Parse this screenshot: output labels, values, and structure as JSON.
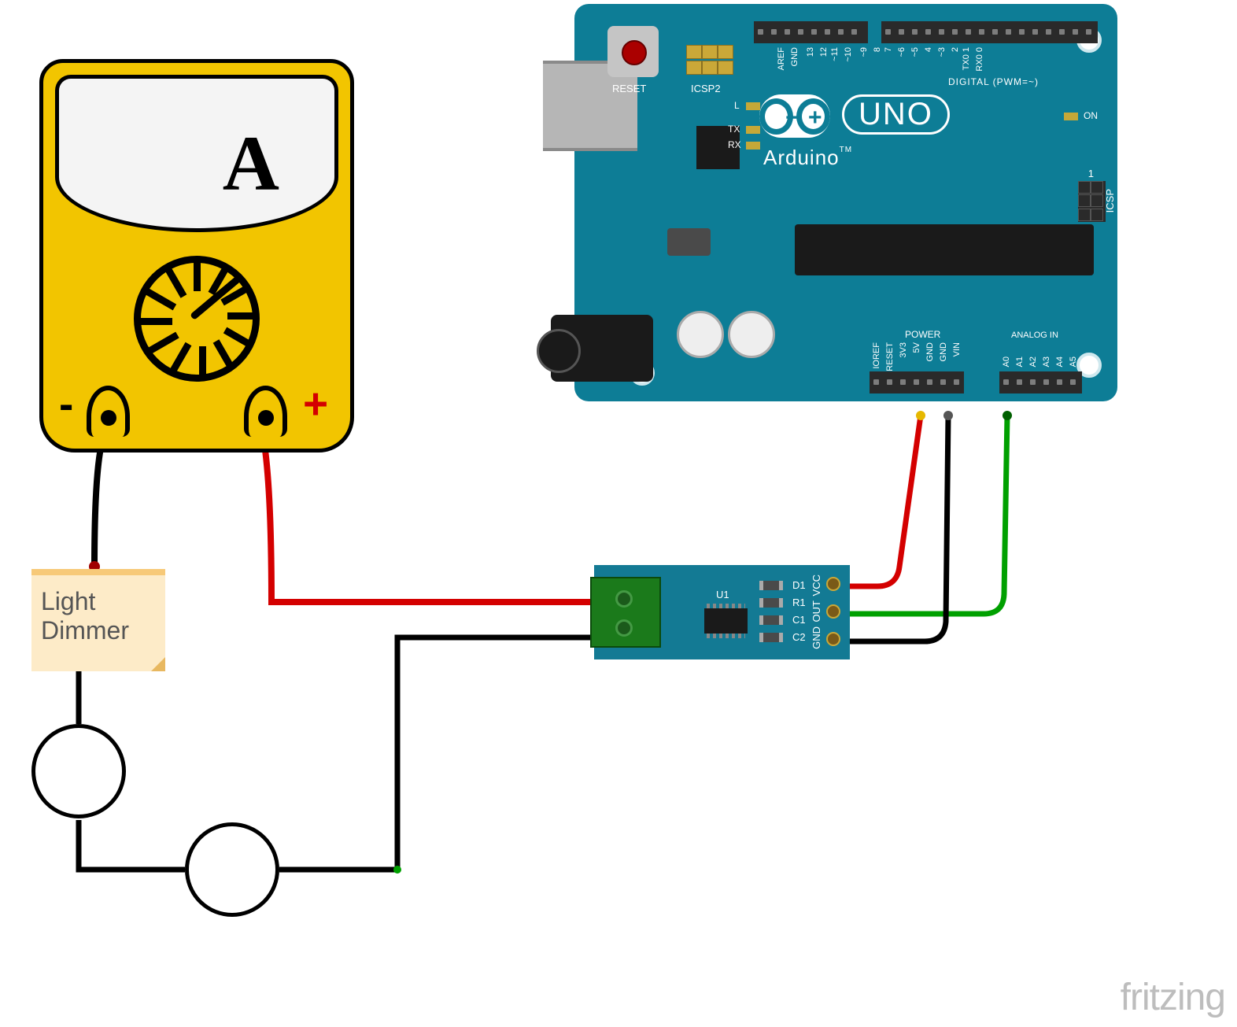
{
  "ammeter": {
    "unit": "A",
    "neg_sign": "-",
    "pos_sign": "+"
  },
  "note": {
    "line1": "Light",
    "line2": "Dimmer"
  },
  "arduino": {
    "brand": "Arduino",
    "tm": "TM",
    "model": "UNO",
    "reset_label": "RESET",
    "icsp2_label": "ICSP2",
    "icsp_label": "ICSP",
    "on_label": "ON",
    "l_label": "L",
    "tx_label": "TX",
    "rx_label": "RX",
    "digital_section": "DIGITAL (PWM=~)",
    "power_section": "POWER",
    "analog_section": "ANALOG IN",
    "icsp_one": "1",
    "top_pins": [
      "AREF",
      "GND",
      "13",
      "12",
      "~11",
      "~10",
      "~9",
      "8",
      "7",
      "~6",
      "~5",
      "4",
      "~3",
      "2",
      "TX0 1",
      "RX0 0"
    ],
    "bottom_power_pins": [
      "IOREF",
      "RESET",
      "3V3",
      "5V",
      "GND",
      "GND",
      "VIN"
    ],
    "bottom_analog_pins": [
      "A0",
      "A1",
      "A2",
      "A3",
      "A4",
      "A5"
    ]
  },
  "sensor": {
    "ic_label": "U1",
    "components": [
      "D1",
      "R1",
      "C1",
      "C2"
    ],
    "pins": [
      "GND",
      "OUT",
      "VCC"
    ]
  },
  "symbols": {
    "ac_source": "ac-source",
    "lamp": "lamp"
  },
  "watermark": "fritzing",
  "wires": {
    "colors": {
      "red": "#d40000",
      "black": "#000000",
      "green": "#00A000"
    }
  }
}
